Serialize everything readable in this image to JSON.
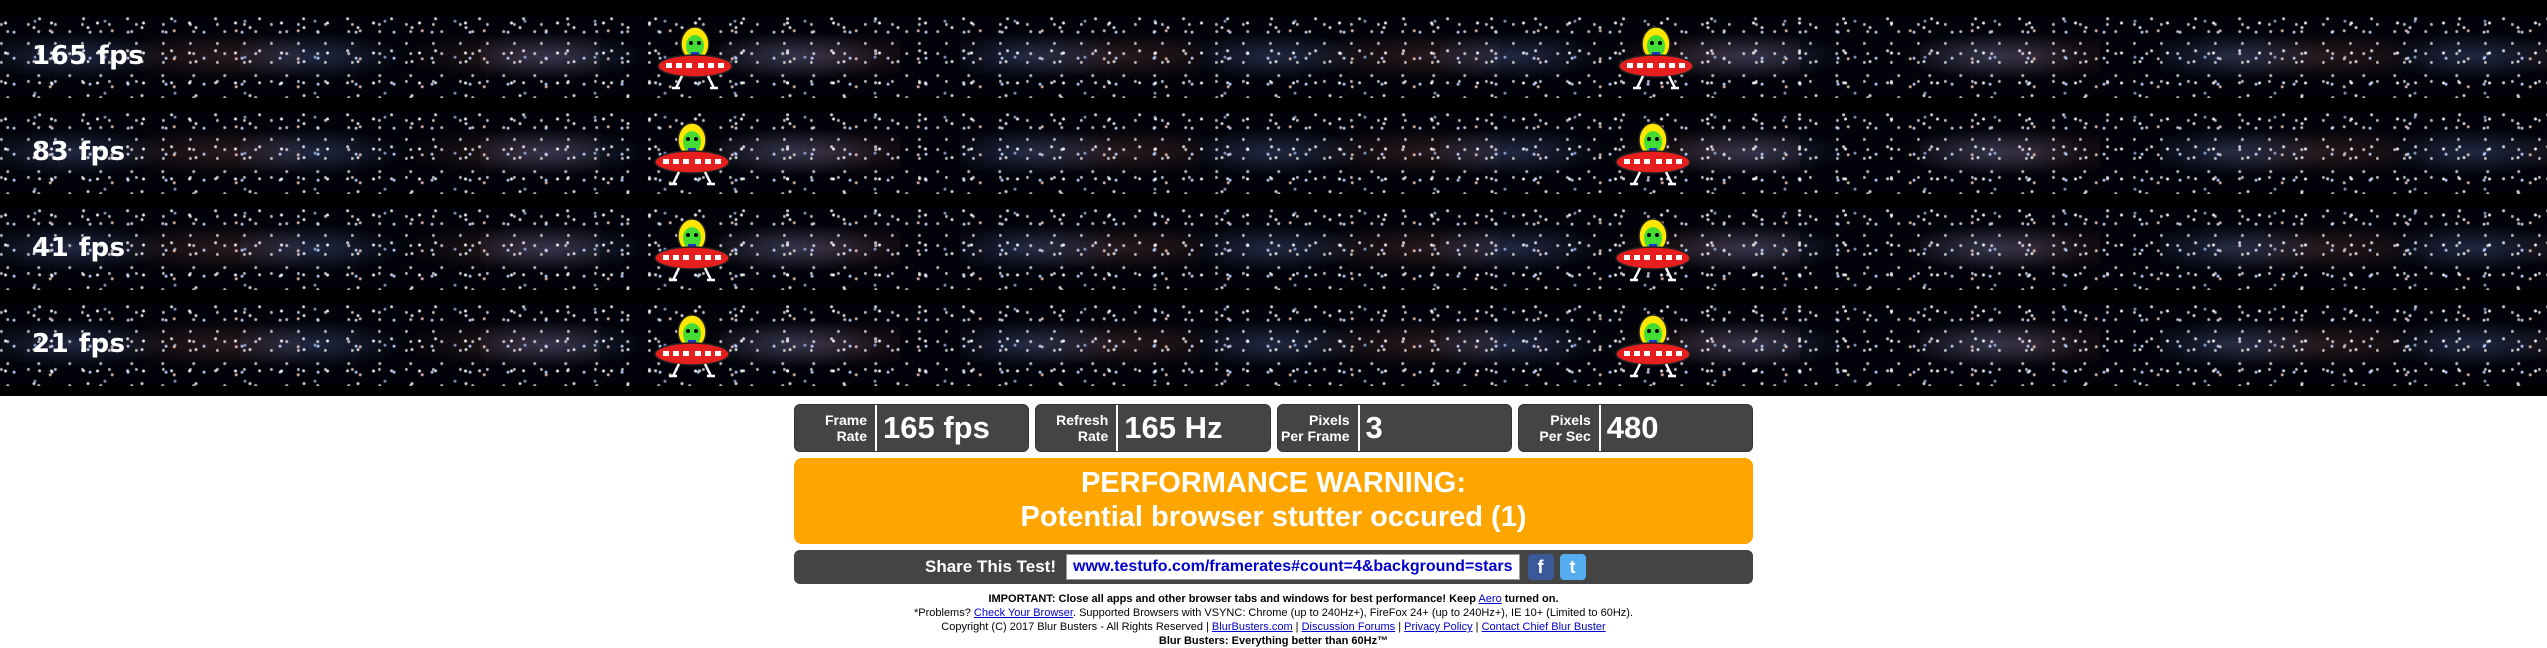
{
  "lanes": [
    {
      "label": "165 fps"
    },
    {
      "label": "83 fps"
    },
    {
      "label": "41 fps"
    },
    {
      "label": "21 fps"
    }
  ],
  "stats": [
    {
      "name_line1": "Frame",
      "name_line2": "Rate",
      "value": "165 fps"
    },
    {
      "name_line1": "Refresh",
      "name_line2": "Rate",
      "value": "165 Hz"
    },
    {
      "name_line1": "Pixels",
      "name_line2": "Per Frame",
      "value": "3"
    },
    {
      "name_line1": "Pixels",
      "name_line2": "Per Sec",
      "value": "480"
    }
  ],
  "warning": {
    "title": "PERFORMANCE WARNING:",
    "message": "Potential browser stutter occured (1)"
  },
  "share": {
    "label": "Share This Test!",
    "url": "www.testufo.com/framerates#count=4&background=stars",
    "facebook": "f",
    "twitter": "t"
  },
  "footer": {
    "important_prefix": "IMPORTANT: Close all apps and other browser tabs and windows for best performance! Keep",
    "aero_link": "Aero",
    "important_suffix": "turned on.",
    "problems_prefix": "*Problems?",
    "check_browser_link": "Check Your Browser",
    "supported": ". Supported Browsers with VSYNC: Chrome (up to 240Hz+), FireFox 24+ (up to 240Hz+), IE 10+ (Limited to 60Hz).",
    "copyright": "Copyright (C) 2017 Blur Busters - All Rights Reserved |",
    "links": [
      "BlurBusters.com",
      "Discussion Forums",
      "Privacy Policy",
      "Contact Chief Blur Buster"
    ],
    "tagline": "Blur Busters: Everything better than 60Hz™"
  },
  "colors": {
    "warning": "#ffa500",
    "panel": "#444444",
    "link": "#0000cc",
    "facebook": "#3b5998",
    "twitter": "#55acee"
  }
}
